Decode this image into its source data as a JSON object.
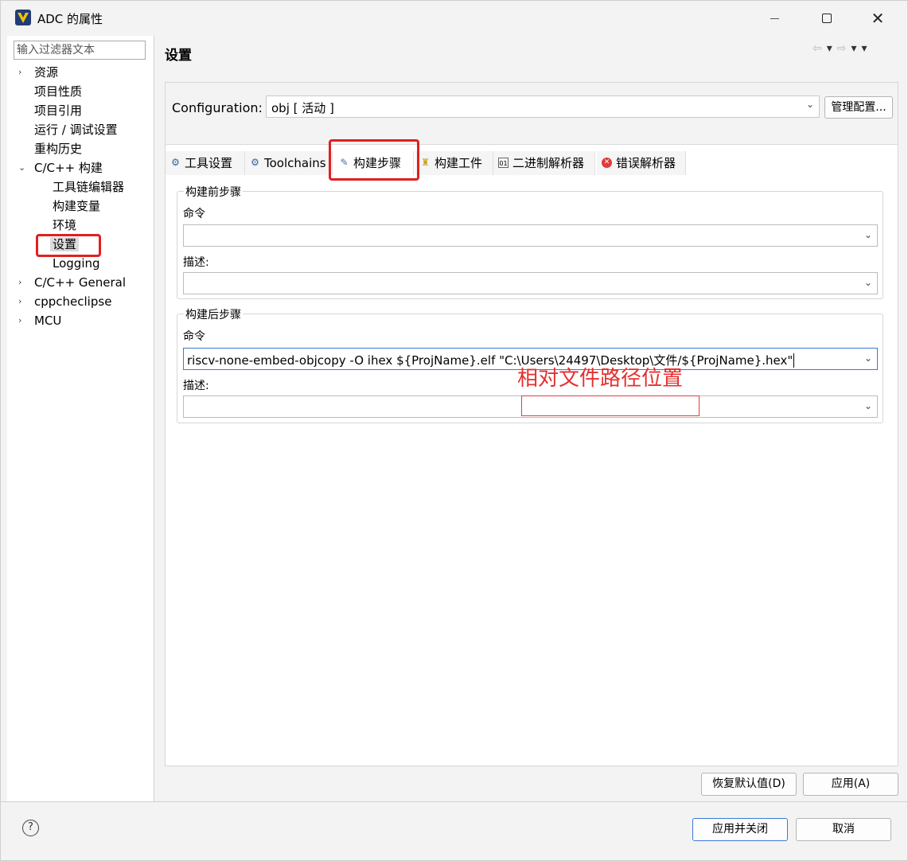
{
  "window": {
    "title": "ADC 的属性"
  },
  "left_panel": {
    "filter_placeholder": "输入过滤器文本",
    "tree": [
      {
        "label": "资源",
        "expander": "›"
      },
      {
        "label": "项目性质"
      },
      {
        "label": "项目引用"
      },
      {
        "label": "运行 / 调试设置"
      },
      {
        "label": "重构历史"
      },
      {
        "label": "C/C++ 构建",
        "expander": "⌄"
      },
      {
        "label": "工具链编辑器"
      },
      {
        "label": "构建变量"
      },
      {
        "label": "环境"
      },
      {
        "label": "设置"
      },
      {
        "label": "Logging"
      },
      {
        "label": "C/C++ General",
        "expander": "›"
      },
      {
        "label": "cppcheclipse",
        "expander": "›"
      },
      {
        "label": "MCU",
        "expander": "›"
      }
    ]
  },
  "main": {
    "title": "设置",
    "configuration_label": "Configuration:",
    "configuration_value": "obj  [ 活动 ]",
    "manage_button": "管理配置...",
    "tabs": [
      {
        "label": "工具设置",
        "icon": "tool-settings-icon"
      },
      {
        "label": "Toolchains",
        "icon": "toolchains-icon"
      },
      {
        "label": "构建步骤",
        "icon": "build-steps-icon"
      },
      {
        "label": "构建工件",
        "icon": "build-artifact-icon"
      },
      {
        "label": "二进制解析器",
        "icon": "binary-parser-icon"
      },
      {
        "label": "错误解析器",
        "icon": "error-parser-icon"
      }
    ],
    "pre_build": {
      "title": "构建前步骤",
      "command_label": "命令",
      "command_value": "",
      "description_label": "描述:",
      "description_value": ""
    },
    "post_build": {
      "title": "构建后步骤",
      "command_label": "命令",
      "command_value": "riscv-none-embed-objcopy -O ihex ${ProjName}.elf  \"C:\\Users\\24497\\Desktop\\文件/${ProjName}.hex\"",
      "description_label": "描述:",
      "description_value": ""
    },
    "annotation": "相对文件路径位置",
    "restore_defaults_button": "恢复默认值(D)",
    "apply_button": "应用(A)"
  },
  "footer": {
    "help": "?",
    "apply_close_button": "应用并关闭",
    "cancel_button": "取消"
  },
  "colors": {
    "highlight_red": "#e02020",
    "focus_blue": "#3a7bd5"
  }
}
